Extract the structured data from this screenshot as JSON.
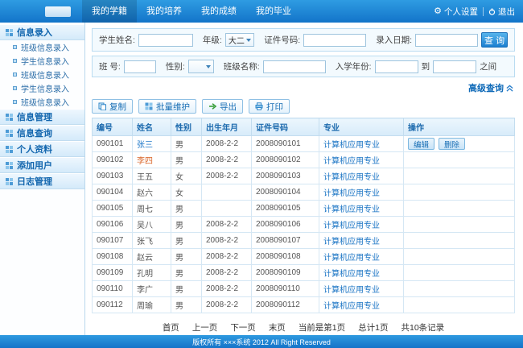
{
  "header": {
    "nav": [
      {
        "label": "我的学籍",
        "active": true
      },
      {
        "label": "我的培养",
        "active": false
      },
      {
        "label": "我的成绩",
        "active": false
      },
      {
        "label": "我的毕业",
        "active": false
      }
    ],
    "settings_label": "个人设置",
    "logout_label": "退出"
  },
  "sidebar": {
    "sections": [
      {
        "label": "信息录入",
        "items": [
          "班级信息录入",
          "学生信息录入",
          "班级信息录入",
          "学生信息录入",
          "班级信息录入"
        ]
      },
      {
        "label": "信息管理",
        "items": []
      },
      {
        "label": "信息查询",
        "items": []
      },
      {
        "label": "个人资料",
        "items": []
      },
      {
        "label": "添加用户",
        "items": []
      },
      {
        "label": "日志管理",
        "items": []
      }
    ]
  },
  "search": {
    "student_name_label": "学生姓名:",
    "grade_label": "年级:",
    "grade_value": "大二",
    "cert_label": "证件号码:",
    "entry_date_label": "录入日期:",
    "search_button": "查 询",
    "class_no_label": "班 号:",
    "gender_label": "性别:",
    "gender_value": "",
    "class_name_label": "班级名称:",
    "enroll_year_label": "入学年份:",
    "to_label": "到",
    "between_label": "之间",
    "advanced_label": "高级查询"
  },
  "toolbar": {
    "copy": "复制",
    "batch": "批量维护",
    "export": "导出",
    "print": "打印"
  },
  "table": {
    "headers": [
      "编号",
      "姓名",
      "性别",
      "出生年月",
      "证件号码",
      "专业",
      "操作"
    ],
    "edit_label": "编辑",
    "delete_label": "删除",
    "rows": [
      {
        "id": "090101",
        "name": "张三",
        "name_color": "#1f78c8",
        "gender": "男",
        "birth": "2008-2-2",
        "cert": "2008090101",
        "major": "计算机应用专业",
        "ops": true
      },
      {
        "id": "090102",
        "name": "李四",
        "name_color": "#d9662a",
        "gender": "男",
        "birth": "2008-2-2",
        "cert": "2008090102",
        "major": "计算机应用专业",
        "ops": false
      },
      {
        "id": "090103",
        "name": "王五",
        "gender": "女",
        "birth": "2008-2-2",
        "cert": "2008090103",
        "major": "计算机应用专业",
        "ops": false
      },
      {
        "id": "090104",
        "name": "赵六",
        "gender": "女",
        "birth": "",
        "cert": "2008090104",
        "major": "计算机应用专业",
        "ops": false
      },
      {
        "id": "090105",
        "name": "周七",
        "gender": "男",
        "birth": "",
        "cert": "2008090105",
        "major": "计算机应用专业",
        "ops": false
      },
      {
        "id": "090106",
        "name": "吴八",
        "gender": "男",
        "birth": "2008-2-2",
        "cert": "2008090106",
        "major": "计算机应用专业",
        "ops": false
      },
      {
        "id": "090107",
        "name": "张飞",
        "gender": "男",
        "birth": "2008-2-2",
        "cert": "2008090107",
        "major": "计算机应用专业",
        "ops": false
      },
      {
        "id": "090108",
        "name": "赵云",
        "gender": "男",
        "birth": "2008-2-2",
        "cert": "2008090108",
        "major": "计算机应用专业",
        "ops": false
      },
      {
        "id": "090109",
        "name": "孔明",
        "gender": "男",
        "birth": "2008-2-2",
        "cert": "2008090109",
        "major": "计算机应用专业",
        "ops": false
      },
      {
        "id": "090110",
        "name": "李广",
        "gender": "男",
        "birth": "2008-2-2",
        "cert": "2008090110",
        "major": "计算机应用专业",
        "ops": false
      },
      {
        "id": "090112",
        "name": "周瑜",
        "gender": "男",
        "birth": "2008-2-2",
        "cert": "2008090112",
        "major": "计算机应用专业",
        "ops": false
      }
    ]
  },
  "pagination": {
    "links": [
      "首页",
      "上一页",
      "下一页",
      "末页"
    ],
    "info": [
      "当前是第1页",
      "总计1页",
      "共10条记录"
    ]
  },
  "footer": {
    "copyright": "版权所有 ×××系统 2012 All Right Reserved"
  }
}
